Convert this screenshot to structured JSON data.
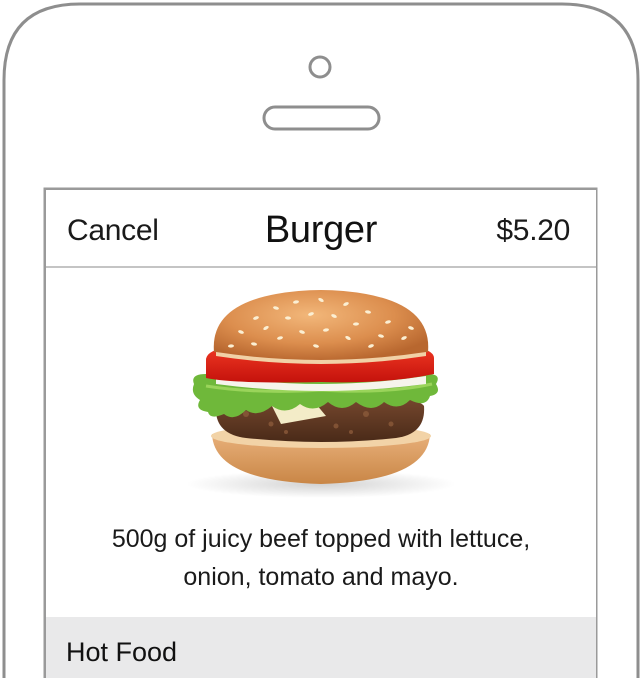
{
  "nav": {
    "cancel_label": "Cancel",
    "title": "Burger",
    "price": "$5.20"
  },
  "item": {
    "image": "burger-photo",
    "description_line1": "500g of juicy beef topped with lettuce,",
    "description_line2": "onion, tomato and mayo."
  },
  "section": {
    "title": "Hot Food"
  },
  "colors": {
    "frame": "#8e8e8e",
    "divider": "#c4c4c4",
    "section_bg": "#e9e9ea",
    "text": "#1a1a1a"
  }
}
